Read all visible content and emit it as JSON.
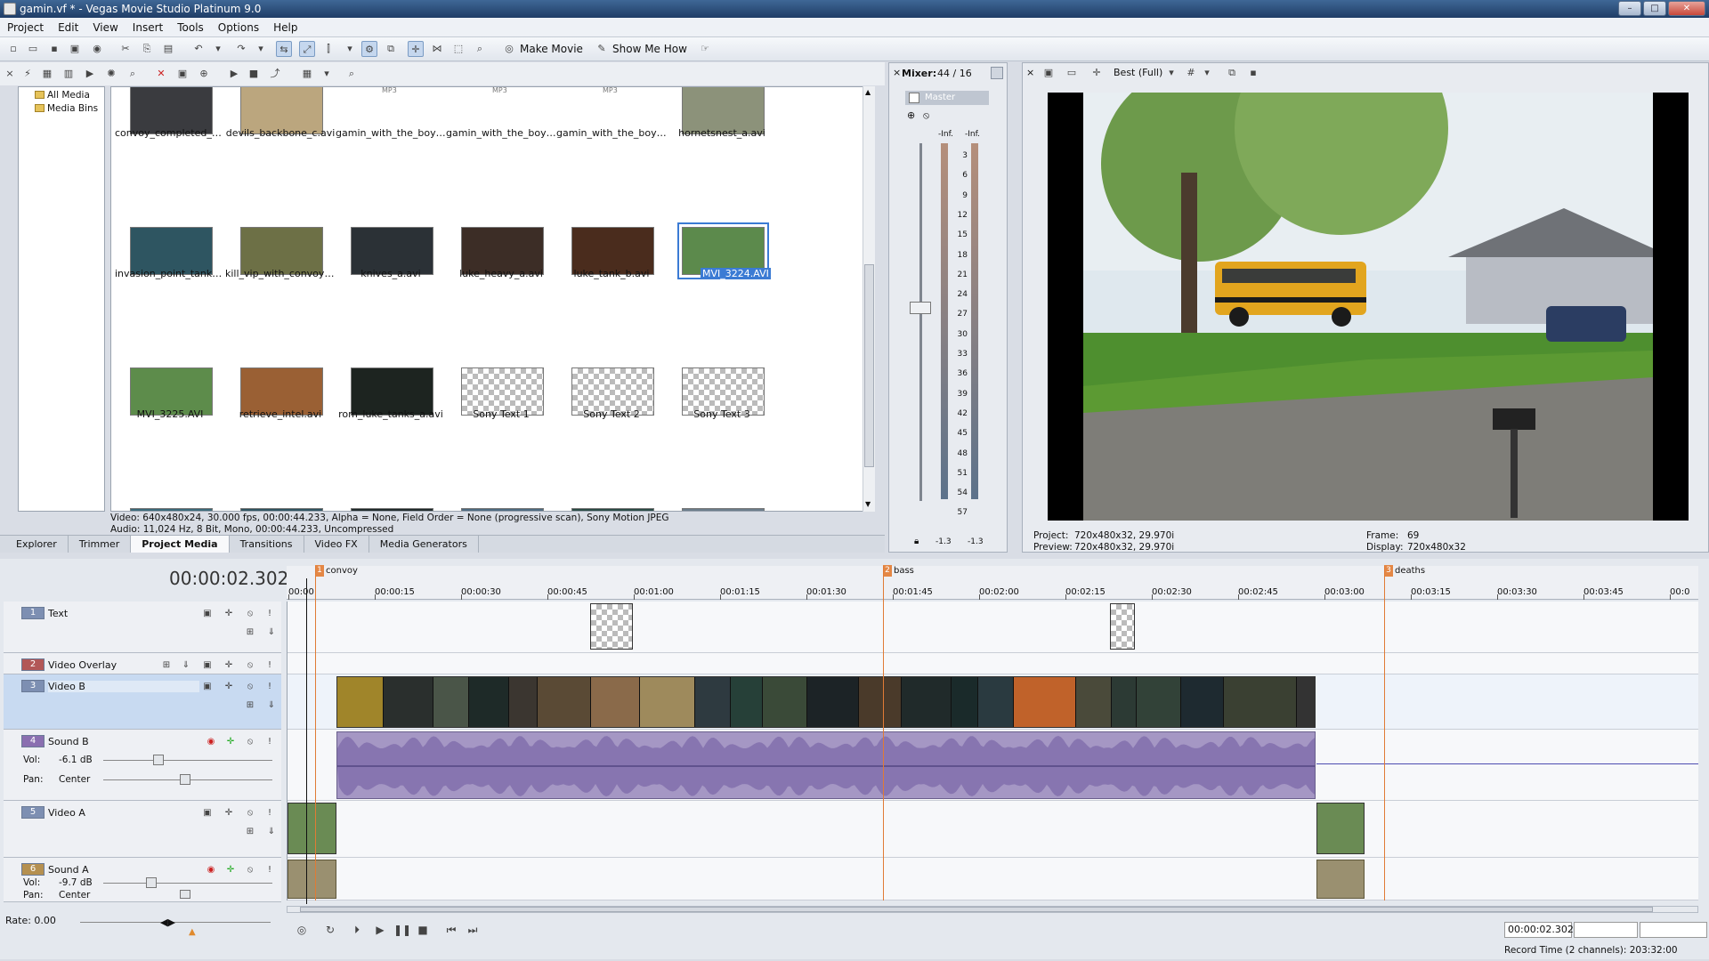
{
  "window": {
    "title": "gamin.vf * - Vegas Movie Studio Platinum 9.0",
    "controls": [
      "–",
      "□",
      "✕"
    ]
  },
  "menu": [
    "Project",
    "Edit",
    "View",
    "Insert",
    "Tools",
    "Options",
    "Help"
  ],
  "toolbar": {
    "make_movie": "Make Movie",
    "show_me_how": "Show Me How"
  },
  "tree": {
    "items": [
      "All Media",
      "Media Bins"
    ]
  },
  "media": {
    "items": [
      {
        "label": "convoy_completed_a.avi",
        "thumb": "#3a3b3f"
      },
      {
        "label": "devils_backbone_c.avi",
        "thumb": "#bba67e"
      },
      {
        "label": "gamin_with_the_boys_...",
        "thumb": "#ffffff"
      },
      {
        "label": "gamin_with_the_boys_...",
        "thumb": "#ffffff"
      },
      {
        "label": "gamin_with_the_boys_...",
        "thumb": "#ffffff"
      },
      {
        "label": "hornetsnest_a.avi",
        "thumb": "#8c927a"
      },
      {
        "label": "invasion_point_tank_a...",
        "thumb": "#2e5561"
      },
      {
        "label": "kill_vip_with_convoy_a...",
        "thumb": "#6d7046"
      },
      {
        "label": "knives_a.avi",
        "thumb": "#2b3136"
      },
      {
        "label": "luke_heavy_a.avi",
        "thumb": "#3c2d26"
      },
      {
        "label": "luke_tank_b.avi",
        "thumb": "#4a2c1d"
      },
      {
        "label": "MVI_3224.AVI",
        "thumb": "#5c8a4c",
        "selected": true
      },
      {
        "label": "MVI_3225.AVI",
        "thumb": "#5d8c4b"
      },
      {
        "label": "retrieve_intel.avi",
        "thumb": "#9a6034"
      },
      {
        "label": "rom_luke_tanks_a.avi",
        "thumb": "#1d2420"
      },
      {
        "label": "Sony Text 1",
        "thumb": "checker"
      },
      {
        "label": "Sony Text 2",
        "thumb": "checker"
      },
      {
        "label": "Sony Text 3",
        "thumb": "checker"
      },
      {
        "label": "",
        "thumb": "#3a6a7a"
      },
      {
        "label": "",
        "thumb": "#2f5360"
      },
      {
        "label": "",
        "thumb": "#1f2a2a"
      },
      {
        "label": "",
        "thumb": "#4d6b80"
      },
      {
        "label": "",
        "thumb": "#2a4b45"
      },
      {
        "label": "",
        "thumb": "#6b7c8a"
      }
    ],
    "mp3_tag": "MP3",
    "status_video": "Video: 640x480x24, 30.000 fps, 00:00:44.233, Alpha = None, Field Order = None (progressive scan), Sony Motion JPEG",
    "status_audio": "Audio: 11,024 Hz, 8 Bit, Mono, 00:00:44.233, Uncompressed"
  },
  "tabs": [
    {
      "label": "Explorer",
      "active": false
    },
    {
      "label": "Trimmer",
      "active": false
    },
    {
      "label": "Project Media",
      "active": true
    },
    {
      "label": "Transitions",
      "active": false
    },
    {
      "label": "Video FX",
      "active": false
    },
    {
      "label": "Media Generators",
      "active": false
    }
  ],
  "mixer": {
    "title": "Mixer:",
    "count": "44 / 16",
    "master": "Master",
    "peak_left": "-Inf.",
    "peak_right": "-Inf.",
    "scale": [
      "3",
      "6",
      "9",
      "12",
      "15",
      "18",
      "21",
      "24",
      "27",
      "30",
      "33",
      "36",
      "39",
      "42",
      "45",
      "48",
      "51",
      "54",
      "57"
    ],
    "bottom_left": "-1.3",
    "bottom_right": "-1.3"
  },
  "preview": {
    "quality": "Best (Full)",
    "project_label": "Project:",
    "project_value": "720x480x32, 29.970i",
    "preview_label": "Preview:",
    "preview_value": "720x480x32, 29.970i",
    "frame_label": "Frame:",
    "frame_value": "69",
    "display_label": "Display:",
    "display_value": "720x480x32"
  },
  "timeline": {
    "time": "00:00:02.302",
    "ruler": [
      "00:00",
      "00:00:15",
      "00:00:30",
      "00:00:45",
      "00:01:00",
      "00:01:15",
      "00:01:30",
      "00:01:45",
      "00:02:00",
      "00:02:15",
      "00:02:30",
      "00:02:45",
      "00:03:00",
      "00:03:15",
      "00:03:30",
      "00:03:45",
      "00:0"
    ],
    "markers": [
      {
        "num": "1",
        "label": "convoy"
      },
      {
        "num": "2",
        "label": "bass"
      },
      {
        "num": "3",
        "label": "deaths"
      }
    ],
    "tracks": [
      {
        "num": "1",
        "name": "Text",
        "color": "#7d8fb2"
      },
      {
        "num": "2",
        "name": "Video Overlay",
        "color": "#b25757"
      },
      {
        "num": "3",
        "name": "Video B",
        "color": "#7d8fb2"
      },
      {
        "num": "4",
        "name": "Sound B",
        "color": "#8a6fb0"
      },
      {
        "num": "5",
        "name": "Video A",
        "color": "#7d8fb2"
      },
      {
        "num": "6",
        "name": "Sound A",
        "color": "#b59050"
      }
    ],
    "sound_b": {
      "vol_label": "Vol:",
      "vol": "-6.1 dB",
      "pan_label": "Pan:",
      "pan": "Center"
    },
    "sound_a": {
      "vol_label": "Vol:",
      "vol": "-9.7 dB",
      "pan_label": "Pan:",
      "pan": "Center"
    },
    "rate": "Rate: 0.00",
    "end_time": "00:00:02.302",
    "record_time": "Record Time (2 channels): 203:32:00"
  }
}
